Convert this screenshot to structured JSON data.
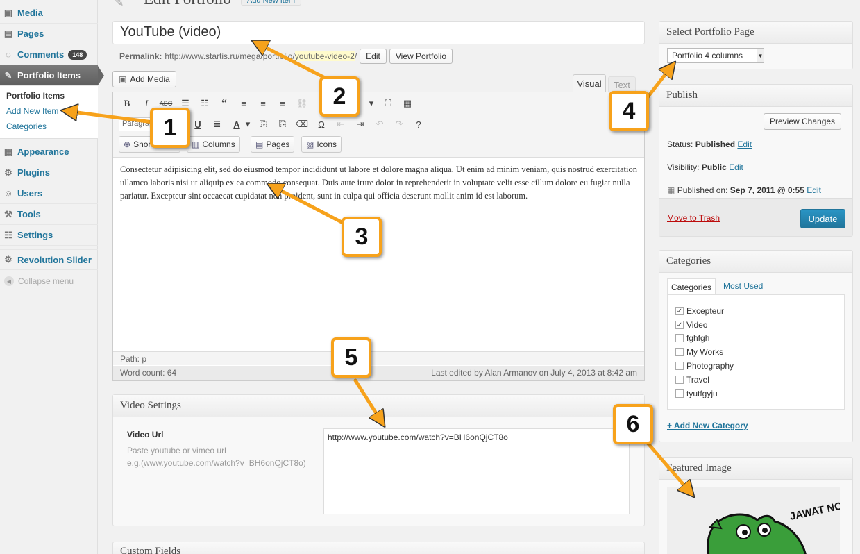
{
  "sidebar": {
    "items": [
      {
        "label": "Media",
        "icon": "media-icon"
      },
      {
        "label": "Pages",
        "icon": "pages-icon"
      },
      {
        "label": "Comments",
        "icon": "comments-icon",
        "badge": "148"
      },
      {
        "label": "Portfolio Items",
        "icon": "pin-icon"
      },
      {
        "label": "Appearance",
        "icon": "appearance-icon"
      },
      {
        "label": "Plugins",
        "icon": "plugins-icon"
      },
      {
        "label": "Users",
        "icon": "users-icon"
      },
      {
        "label": "Tools",
        "icon": "tools-icon"
      },
      {
        "label": "Settings",
        "icon": "settings-icon"
      },
      {
        "label": "Revolution Slider",
        "icon": "slider-icon"
      }
    ],
    "submenu": [
      "Portfolio Items",
      "Add New Item",
      "Categories"
    ],
    "collapse": "Collapse menu"
  },
  "header": {
    "title": "Edit Portfolio",
    "add_new": "Add New Item"
  },
  "post": {
    "title": "YouTube (video)",
    "permalink_label": "Permalink:",
    "permalink_base": "http://www.startis.ru/mega/portfolio/",
    "permalink_slug": "youtube-video-2",
    "permalink_end": "/",
    "edit_button": "Edit",
    "view_button": "View Portfolio"
  },
  "editor": {
    "add_media": "Add Media",
    "tab_visual": "Visual",
    "tab_text": "Text",
    "format": "Paragraph",
    "shortcodes_button": "Shortcodes",
    "columns_button": "Columns",
    "pages_button": "Pages",
    "icons_button": "Icons",
    "content": "Consectetur adipisicing elit, sed do eiusmod tempor incididunt ut labore et dolore magna aliqua. Ut enim ad minim veniam, quis nostrud exercitation ullamco laboris nisi ut aliquip ex ea commodo consequat. Duis aute irure dolor in reprehenderit in voluptate velit esse cillum dolore eu fugiat nulla pariatur. Excepteur sint occaecat cupidatat non proident, sunt in culpa qui officia deserunt mollit anim id est laborum.",
    "path": "Path: p",
    "word_count": "Word count: 64",
    "last_edited": "Last edited by Alan Armanov on July 4, 2013 at 8:42 am"
  },
  "video_settings": {
    "title": "Video Settings",
    "label": "Video Url",
    "desc1": "Paste youtube or vimeo url",
    "desc2": "e.g.(www.youtube.com/watch?v=BH6onQjCT8o)",
    "value": "http://www.youtube.com/watch?v=BH6onQjCT8o"
  },
  "custom_fields": {
    "title": "Custom Fields"
  },
  "portfolio_page": {
    "title": "Select Portfolio Page",
    "selected": "Portfolio 4 columns"
  },
  "publish": {
    "title": "Publish",
    "preview": "Preview Changes",
    "status_label": "Status:",
    "status_value": "Published",
    "visibility_label": "Visibility:",
    "visibility_value": "Public",
    "published_label": "Published on:",
    "published_value": "Sep 7, 2011 @ 0:55",
    "edit_link": "Edit",
    "trash": "Move to Trash",
    "update": "Update"
  },
  "categories": {
    "title": "Categories",
    "tab_all": "Categories",
    "tab_popular": "Most Used",
    "items": [
      {
        "label": "Excepteur",
        "checked": true
      },
      {
        "label": "Video",
        "checked": true
      },
      {
        "label": "fghfgh",
        "checked": false
      },
      {
        "label": "My Works",
        "checked": false
      },
      {
        "label": "Photography",
        "checked": false
      },
      {
        "label": "Travel",
        "checked": false
      },
      {
        "label": "tyutfgyju",
        "checked": false
      }
    ],
    "add_new": "+ Add New Category"
  },
  "featured_image": {
    "title": "Featured Image",
    "image_text": "JAWAT NOU?!"
  },
  "callouts": [
    "1",
    "2",
    "3",
    "4",
    "5",
    "6"
  ],
  "colors": {
    "accent": "#21759b",
    "callout_border": "#f7a21b",
    "arrow": "#f7a21b",
    "trash": "#bc0b0b"
  }
}
